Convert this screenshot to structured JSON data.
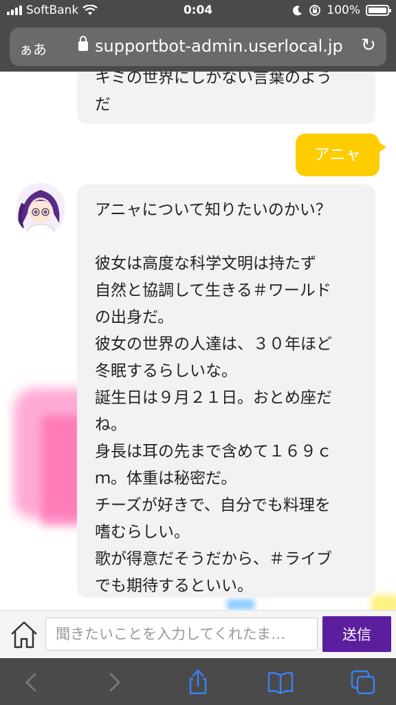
{
  "status": {
    "carrier": "SoftBank",
    "time": "0:04",
    "battery": "100%",
    "battery_level": 1.0
  },
  "browser": {
    "text_size_button": "ぁあ",
    "url": "supportbot-admin.userlocal.jp"
  },
  "messages": {
    "bot1_lines": [
      "キミの世界にしかない言葉のよう",
      "だ"
    ],
    "user_message": "アニャ",
    "bot2_lines": [
      "アニャについて知りたいのかい？",
      "",
      "彼女は高度な科学文明は持たず",
      "自然と協調して生きる＃ワールド",
      "の出身だ。",
      "彼女の世界の人達は、３０年ほど",
      "冬眠するらしいな。",
      "誕生日は９月２１日。おとめ座だ",
      "ね。",
      "身長は耳の先まで含めて１６９ｃ",
      "ｍ。体重は秘密だ。",
      "チーズが好きで、自分でも料理を",
      "嗜むらしい。",
      "歌が得意だそうだから、＃ライブ",
      "でも期待するといい。"
    ]
  },
  "input": {
    "placeholder": "聞きたいことを入力してくれたま…",
    "value": "",
    "send_label": "送信"
  },
  "colors": {
    "user_bubble": "#ffcc00",
    "send_button": "#5a1e9e",
    "bot_bubble": "#f2f2f2",
    "toolbar_icon": "#3b82f6"
  },
  "icons": {
    "home": "home-icon",
    "share": "share-icon",
    "bookmarks": "book-icon",
    "tabs": "tabs-icon"
  }
}
